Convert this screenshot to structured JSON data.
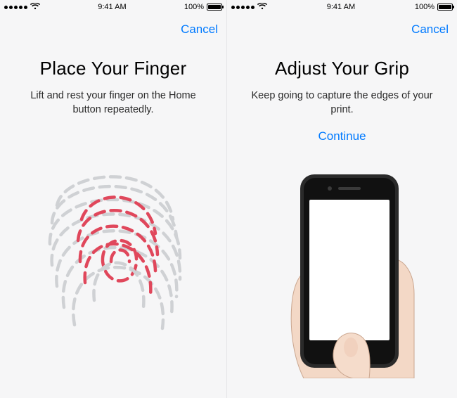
{
  "status": {
    "time": "9:41 AM",
    "battery_pct": "100%",
    "signal_strength": 5,
    "wifi": true
  },
  "left": {
    "nav": {
      "cancel": "Cancel"
    },
    "title": "Place Your Finger",
    "subtitle": "Lift and rest your finger on the Home button repeatedly.",
    "icon": "fingerprint-icon",
    "colors": {
      "highlight": "#e0475b",
      "base": "#cfd1d4"
    }
  },
  "right": {
    "nav": {
      "cancel": "Cancel"
    },
    "title": "Adjust Your Grip",
    "subtitle": "Keep going to capture the edges of your print.",
    "continue": "Continue",
    "illustration": "phone-in-hand"
  },
  "colors": {
    "link": "#007aff",
    "background": "#f6f6f7"
  }
}
